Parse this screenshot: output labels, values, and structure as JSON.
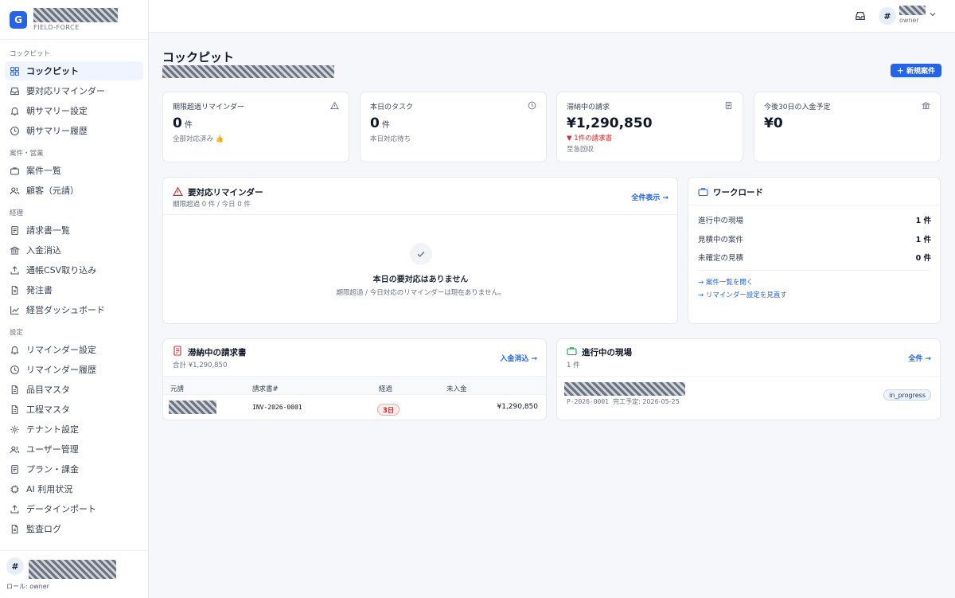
{
  "brand": {
    "logo_letter": "G",
    "subtitle": "FIELD-FORCE"
  },
  "sidebar": {
    "sections": [
      {
        "title": "コックピット",
        "items": [
          {
            "label": "コックピット",
            "icon": "grid-icon",
            "active": true
          },
          {
            "label": "要対応リマインダー",
            "icon": "inbox-icon"
          },
          {
            "label": "朝サマリー設定",
            "icon": "bell-icon"
          },
          {
            "label": "朝サマリー履歴",
            "icon": "clock-icon"
          }
        ]
      },
      {
        "title": "案件・営業",
        "items": [
          {
            "label": "案件一覧",
            "icon": "briefcase-icon"
          },
          {
            "label": "顧客（元請）",
            "icon": "users-icon"
          }
        ]
      },
      {
        "title": "経理",
        "items": [
          {
            "label": "請求書一覧",
            "icon": "document-icon"
          },
          {
            "label": "入金消込",
            "icon": "bank-icon"
          },
          {
            "label": "通帳CSV取り込み",
            "icon": "upload-icon"
          },
          {
            "label": "発注書",
            "icon": "file-icon"
          },
          {
            "label": "経営ダッシュボード",
            "icon": "chart-icon"
          }
        ]
      },
      {
        "title": "設定",
        "items": [
          {
            "label": "リマインダー設定",
            "icon": "bell-icon"
          },
          {
            "label": "リマインダー履歴",
            "icon": "clock-icon"
          },
          {
            "label": "品目マスタ",
            "icon": "file-icon"
          },
          {
            "label": "工程マスタ",
            "icon": "file-icon"
          },
          {
            "label": "テナント設定",
            "icon": "gear-icon"
          },
          {
            "label": "ユーザー管理",
            "icon": "users-icon"
          },
          {
            "label": "プラン・課金",
            "icon": "document-icon"
          },
          {
            "label": "AI 利用状況",
            "icon": "chip-icon"
          },
          {
            "label": "データインポート",
            "icon": "upload-icon"
          },
          {
            "label": "監査ログ",
            "icon": "file-icon"
          }
        ]
      }
    ],
    "footer": {
      "avatar": "#",
      "role": "ロール: owner"
    }
  },
  "topbar": {
    "avatar": "#",
    "role": "owner"
  },
  "page": {
    "title": "コックピット",
    "new_button": "＋ 新規案件"
  },
  "stats": [
    {
      "label": "期限超過リマインダー",
      "value": "0",
      "unit": "件",
      "note": "全部対応済み 👍",
      "icon": "warning-icon"
    },
    {
      "label": "本日のタスク",
      "value": "0",
      "unit": "件",
      "note": "本日対応待ち",
      "icon": "clock-icon"
    },
    {
      "label": "滞納中の請求",
      "value": "¥1,290,850",
      "unit": "",
      "alert": "▼ 1件の請求書",
      "note": "至急回収",
      "icon": "document-icon"
    },
    {
      "label": "今後30日の入金予定",
      "value": "¥0",
      "unit": "",
      "note": "",
      "icon": "bank-icon"
    }
  ],
  "reminders": {
    "title": "要対応リマインダー",
    "subtitle": "期限超過 0 件 / 今日 0 件",
    "link": "全件表示 →",
    "empty_title": "本日の要対応はありません",
    "empty_sub": "期限超過 / 今日対応のリマインダーは現在ありません。"
  },
  "workload": {
    "title": "ワークロード",
    "rows": [
      {
        "label": "進行中の現場",
        "value": "1 件"
      },
      {
        "label": "見積中の案件",
        "value": "1 件"
      },
      {
        "label": "未確定の見積",
        "value": "0 件"
      }
    ],
    "links": [
      "→ 案件一覧を開く",
      "→ リマインダー設定を見直す"
    ]
  },
  "overdue": {
    "title": "滞納中の請求書",
    "subtitle": "合計 ¥1,290,850",
    "link": "入金消込 →",
    "columns": [
      "元請",
      "請求書#",
      "経過",
      "未入金"
    ],
    "rows": [
      {
        "invoice": "INV-2026-0001",
        "elapsed": "3日",
        "amount": "¥1,290,850"
      }
    ]
  },
  "sites": {
    "title": "進行中の現場",
    "subtitle": "1 件",
    "link": "全件 →",
    "rows": [
      {
        "code": "P-2026-0001",
        "due": "完工予定: 2026-05-25",
        "status": "in_progress"
      }
    ]
  },
  "colors": {
    "accent": "#2563eb",
    "alert": "#dc2626"
  }
}
